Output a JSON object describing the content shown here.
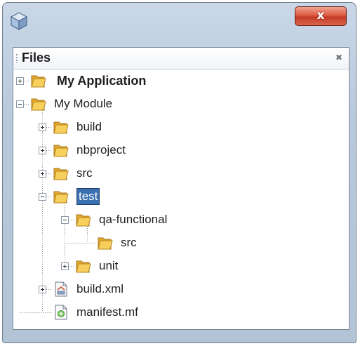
{
  "window": {
    "close_glyph": "x",
    "app_icon": "cube-icon"
  },
  "panel": {
    "title": "Files",
    "close_glyph": "✖"
  },
  "tree": [
    {
      "label": "My Application",
      "icon": "folder-icon",
      "bold": true,
      "expanded": false
    },
    {
      "label": "My Module",
      "icon": "folder-icon",
      "expanded": true
    },
    {
      "label": "build",
      "icon": "folder-icon",
      "expanded": false
    },
    {
      "label": "nbproject",
      "icon": "folder-icon",
      "expanded": false
    },
    {
      "label": "src",
      "icon": "folder-icon",
      "expanded": false
    },
    {
      "label": "test",
      "icon": "folder-icon",
      "expanded": true,
      "selected": true
    },
    {
      "label": "qa-functional",
      "icon": "folder-icon",
      "expanded": true
    },
    {
      "label": "src",
      "icon": "folder-icon"
    },
    {
      "label": "unit",
      "icon": "folder-icon",
      "expanded": false
    },
    {
      "label": "build.xml",
      "icon": "xml-file-icon",
      "expanded": false
    },
    {
      "label": "manifest.mf",
      "icon": "manifest-file-icon"
    }
  ],
  "colors": {
    "selection": "#3a6fb0",
    "folder": "#f2c14e",
    "close_button": "#d9533c"
  }
}
